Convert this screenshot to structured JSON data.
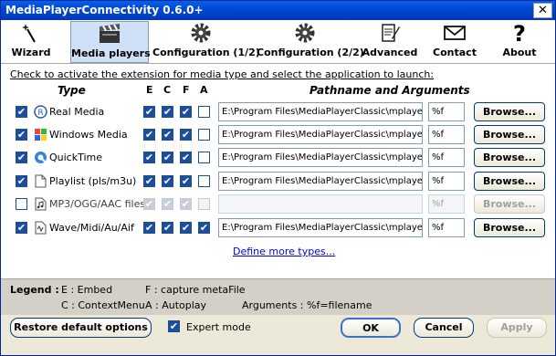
{
  "window": {
    "title": "MediaPlayerConnectivity 0.6.0+",
    "close_label": "✕"
  },
  "toolbar": [
    {
      "label": "Wizard",
      "icon": "wand-icon"
    },
    {
      "label": "Media players",
      "icon": "clapperboard-icon",
      "active": true
    },
    {
      "label": "Configuration (1/2)",
      "icon": "gear-icon"
    },
    {
      "label": "Configuration (2/2)",
      "icon": "gear-icon"
    },
    {
      "label": "Advanced",
      "icon": "notepad-icon"
    },
    {
      "label": "Contact",
      "icon": "envelope-icon"
    },
    {
      "label": "About",
      "icon": "question-icon"
    }
  ],
  "main": {
    "instruction": "Check to activate the extension for media type and select the application to launch:",
    "headers": {
      "type": "Type",
      "e": "E",
      "c": "C",
      "f": "F",
      "a": "A",
      "pathname": "Pathname and Arguments"
    },
    "rows": [
      {
        "name": "Real Media",
        "enabled": true,
        "e": true,
        "c": true,
        "f": true,
        "a": false,
        "path": "E:\\Program Files\\MediaPlayerClassic\\mplayerc.exe",
        "args": "%f",
        "browse": "Browse...",
        "disabled": false
      },
      {
        "name": "Windows Media",
        "enabled": true,
        "e": true,
        "c": true,
        "f": true,
        "a": false,
        "path": "E:\\Program Files\\MediaPlayerClassic\\mplayerc.exe",
        "args": "%f",
        "browse": "Browse...",
        "disabled": false
      },
      {
        "name": "QuickTime",
        "enabled": true,
        "e": true,
        "c": true,
        "f": true,
        "a": false,
        "path": "E:\\Program Files\\MediaPlayerClassic\\mplayerc.exe",
        "args": "%f",
        "browse": "Browse...",
        "disabled": false
      },
      {
        "name": "Playlist (pls/m3u)",
        "enabled": true,
        "e": true,
        "c": true,
        "f": true,
        "a": false,
        "path": "E:\\Program Files\\MediaPlayerClassic\\mplayerc.exe",
        "args": "%f",
        "browse": "Browse...",
        "disabled": false
      },
      {
        "name": "MP3/OGG/AAC files",
        "enabled": false,
        "e": true,
        "c": true,
        "f": true,
        "a": false,
        "path": "",
        "args": "%f",
        "browse": "Browse...",
        "disabled": true
      },
      {
        "name": "Wave/Midi/Au/Aif",
        "enabled": true,
        "e": true,
        "c": true,
        "f": true,
        "a": true,
        "path": "E:\\Program Files\\MediaPlayerClassic\\mplayerc.exe",
        "args": "%f",
        "browse": "Browse...",
        "disabled": false
      }
    ],
    "define_more": "Define more types..."
  },
  "legend": {
    "title": "Legend :",
    "e": "E : Embed",
    "f": "F : capture metaFile",
    "c": "C : ContextMenu",
    "a": "A : Autoplay",
    "args": "Arguments : %f=filename"
  },
  "bottom": {
    "restore": "Restore default options",
    "expert": "Expert mode",
    "expert_checked": true,
    "ok": "OK",
    "cancel": "Cancel",
    "apply": "Apply"
  }
}
